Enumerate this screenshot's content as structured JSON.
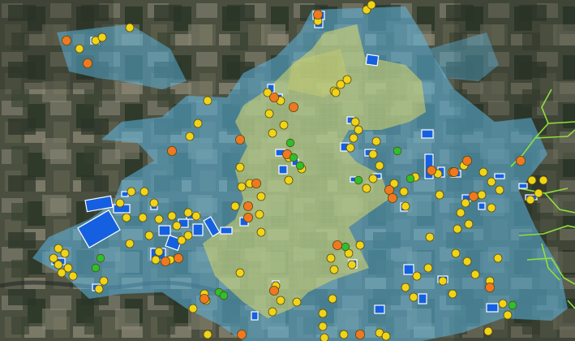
{
  "map": {
    "view": "aerial-imagery",
    "legend": [],
    "layer_colors": {
      "yellow_zone": "#d8d66a",
      "blue_zone": "#5cb8e4",
      "parcels": "#1560e0",
      "boundary_lines": "#8fe03a"
    },
    "marker_colors": {
      "yellow": "#f0d417",
      "orange": "#f07820",
      "green": "#2cc02c"
    },
    "marker_counts": {
      "yellow": 121,
      "orange": 27,
      "green": 12
    }
  }
}
